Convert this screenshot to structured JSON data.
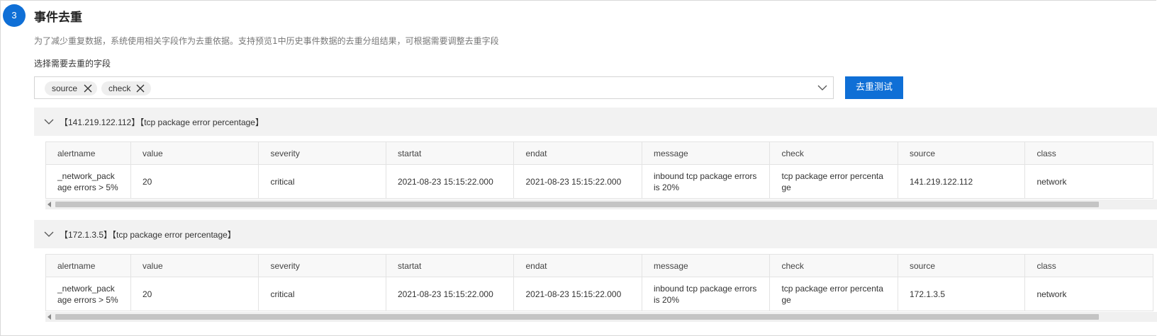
{
  "step": {
    "number": "3",
    "title": "事件去重"
  },
  "description": "为了减少重复数据，系统使用相关字段作为去重依据。支持预览1中历史事件数据的去重分组结果，可根据需要调整去重字段",
  "field_select": {
    "label": "选择需要去重的字段",
    "tags": [
      "source",
      "check"
    ]
  },
  "test_button": {
    "label": "去重测试"
  },
  "colors": {
    "primary": "#0f6fd6",
    "group_header_bg": "#f2f2f2",
    "scroll_thumb": "#c4c4c4"
  },
  "columns": [
    "alertname",
    "value",
    "severity",
    "startat",
    "endat",
    "message",
    "check",
    "source",
    "class"
  ],
  "groups": [
    {
      "title": "【141.219.122.112】【tcp package error percentage】",
      "rows": [
        [
          "_network_package errors > 5%",
          "20",
          "critical",
          "2021-08-23 15:15:22.000",
          "2021-08-23 15:15:22.000",
          "inbound tcp package errors is 20%",
          "tcp package error percentage",
          "141.219.122.112",
          "network"
        ]
      ]
    },
    {
      "title": "【172.1.3.5】【tcp package error percentage】",
      "rows": [
        [
          "_network_package errors > 5%",
          "20",
          "critical",
          "2021-08-23 15:15:22.000",
          "2021-08-23 15:15:22.000",
          "inbound tcp package errors is 20%",
          "tcp package error percentage",
          "172.1.3.5",
          "network"
        ]
      ]
    }
  ]
}
